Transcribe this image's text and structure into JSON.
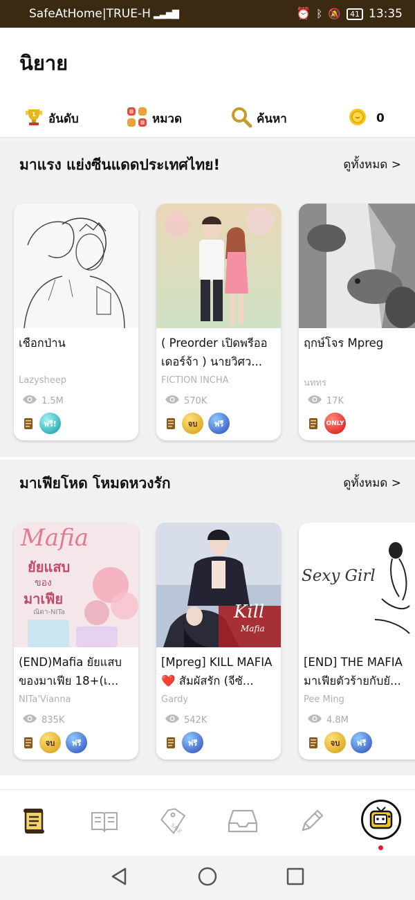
{
  "status_bar": {
    "carrier": "SafeAtHome|TRUE-H",
    "battery": "41",
    "time": "13:35"
  },
  "header": {
    "title": "นิยาย",
    "nav": [
      {
        "label": "อันดับ",
        "icon": "trophy-icon"
      },
      {
        "label": "หมวด",
        "icon": "category-grid-icon"
      },
      {
        "label": "ค้นหา",
        "icon": "search-icon"
      },
      {
        "label": "0",
        "icon": "coin-icon"
      }
    ]
  },
  "sections": [
    {
      "title": "มาแรง แย่งซีนแดดประเทศไทย!",
      "more": "ดูทั้งหมด >",
      "cards": [
        {
          "title": "เชือกป่าน",
          "author": "Lazysheep",
          "views": "1.5M",
          "badges": [
            "ฟรี!"
          ]
        },
        {
          "title": "( Preorder เปิดพรีออเดอร์จ้า ) นายวิศว...",
          "author": "FICTION INCHA",
          "views": "570K",
          "badges": [
            "จบ",
            "ฟรี"
          ]
        },
        {
          "title": "ฤกษ์โจร Mpreg",
          "author": "นททร",
          "views": "17K",
          "badges": [
            "ONLY"
          ]
        }
      ]
    },
    {
      "title": "มาเฟียโหด โหมดหวงรัก",
      "more": "ดูทั้งหมด >",
      "cards": [
        {
          "title": "(END)Mafia ยัยแสบของมาเฟีย 18+(เ...",
          "author": "NITa'Vianna",
          "views": "835K",
          "badges": [
            "จบ",
            "ฟรี"
          ],
          "cover_text": [
            "Mafia",
            "ยัยแสบ",
            "ของ",
            "มาเฟีย",
            "ณิตา-NITa"
          ]
        },
        {
          "title": "[Mpreg] KILL MAFIA ❤️ สัมผัสรัก (จีซั...",
          "author": "Gardy",
          "views": "542K",
          "badges": [
            "ฟรี"
          ],
          "cover_text": [
            "Kill",
            "Mafia"
          ]
        },
        {
          "title": "[END] THE MAFIA มาเฟียตัวร้ายกับยั...",
          "author": "Pee Ming",
          "views": "4.8M",
          "badges": [
            "จบ",
            "ฟรี"
          ],
          "cover_text": [
            "Sexy Girl"
          ]
        }
      ]
    }
  ],
  "bottom_nav": [
    {
      "icon": "novel-scroll-icon",
      "active": true
    },
    {
      "icon": "book-open-icon",
      "active": false
    },
    {
      "icon": "sale-tag-icon",
      "active": false,
      "label": "SALE"
    },
    {
      "icon": "inbox-tray-icon",
      "active": false
    },
    {
      "icon": "pencil-icon",
      "active": false
    },
    {
      "icon": "tv-mascot-icon",
      "active": false
    }
  ],
  "colors": {
    "status_bar": "#3b2a12",
    "accent_gold": "#e8b620",
    "section_bg": "#f1f1f1",
    "notification_dot": "#e3202a"
  }
}
